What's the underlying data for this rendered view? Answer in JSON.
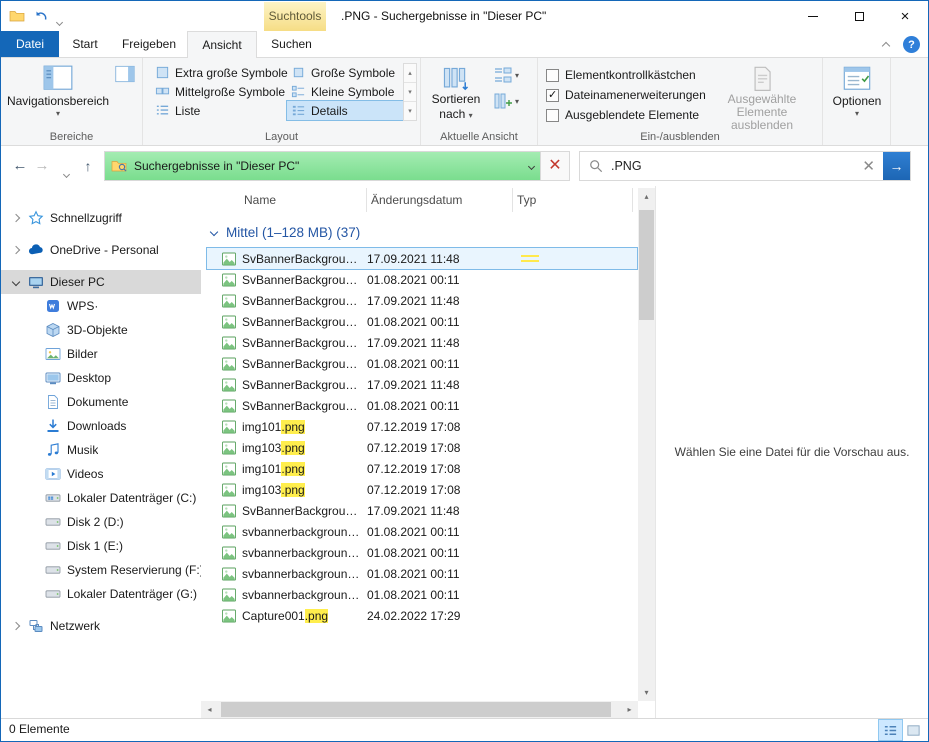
{
  "colors": {
    "accent": "#1467b8",
    "green": "#7add8e",
    "green-light": "#a4ecb2",
    "highlight": "#ffee4d",
    "selbg": "#e9f5fe",
    "selborder": "#7fbbe8",
    "contextual": "#f6dd85"
  },
  "titlebar": {
    "title": ".PNG - Suchergebnisse in \"Dieser PC\"",
    "contextual_tab": "Suchtools"
  },
  "tabs": {
    "file": "Datei",
    "start": "Start",
    "share": "Freigeben",
    "view": "Ansicht",
    "search": "Suchen"
  },
  "ribbon": {
    "panes_group": {
      "label": "Bereiche",
      "nav_pane": "Navigationsbereich"
    },
    "layout_group": {
      "label": "Layout",
      "options": [
        {
          "label": "Extra große Symbole",
          "icon": "xl-icons",
          "selected": false
        },
        {
          "label": "Große Symbole",
          "icon": "l-icons",
          "selected": false
        },
        {
          "label": "Mittelgroße Symbole",
          "icon": "m-icons",
          "selected": false
        },
        {
          "label": "Kleine Symbole",
          "icon": "s-icons",
          "selected": false
        },
        {
          "label": "Liste",
          "icon": "list-view",
          "selected": false
        },
        {
          "label": "Details",
          "icon": "details-view",
          "selected": true
        }
      ]
    },
    "current_view_group": {
      "label": "Aktuelle Ansicht",
      "sort_line1": "Sortieren",
      "sort_line2": "nach"
    },
    "show_hide_group": {
      "label": "Ein-/ausblenden",
      "checkboxes": [
        {
          "label": "Elementkontrollkästchen",
          "checked": false
        },
        {
          "label": "Dateinamenerweiterungen",
          "checked": true
        },
        {
          "label": "Ausgeblendete Elemente",
          "checked": false
        }
      ],
      "hide_selected": "Ausgewählte Elemente ausblenden"
    },
    "options_group": {
      "label": "Optionen"
    }
  },
  "addressbar": {
    "location": "Suchergebnisse in \"Dieser PC\""
  },
  "searchbox": {
    "value": ".PNG"
  },
  "sidebar": {
    "items": [
      {
        "label": "Schnellzugriff",
        "icon": "star",
        "level": 0,
        "chev": "right",
        "gap_after": true
      },
      {
        "label": "OneDrive - Personal",
        "icon": "cloud",
        "level": 0,
        "chev": "right",
        "gap_after": true
      },
      {
        "label": "Dieser PC",
        "icon": "computer",
        "level": 0,
        "chev": "down",
        "selected": true
      },
      {
        "label": "WPS·",
        "icon": "wps",
        "level": 1
      },
      {
        "label": "3D-Objekte",
        "icon": "cube",
        "level": 1
      },
      {
        "label": "Bilder",
        "icon": "picture",
        "level": 1
      },
      {
        "label": "Desktop",
        "icon": "desktop",
        "level": 1
      },
      {
        "label": "Dokumente",
        "icon": "document",
        "level": 1
      },
      {
        "label": "Downloads",
        "icon": "download",
        "level": 1
      },
      {
        "label": "Musik",
        "icon": "music",
        "level": 1
      },
      {
        "label": "Videos",
        "icon": "video",
        "level": 1
      },
      {
        "label": "Lokaler Datenträger (C:)",
        "icon": "drive-win",
        "level": 1
      },
      {
        "label": "Disk 2 (D:)",
        "icon": "drive",
        "level": 1
      },
      {
        "label": "Disk 1 (E:)",
        "icon": "drive",
        "level": 1
      },
      {
        "label": "System Reservierung (F:)",
        "icon": "drive",
        "level": 1
      },
      {
        "label": "Lokaler Datenträger (G:)",
        "icon": "drive",
        "level": 1
      },
      {
        "label": "Netzwerk",
        "icon": "network",
        "level": 0,
        "chev": "right",
        "gap_before": true
      }
    ]
  },
  "filelist": {
    "columns": [
      {
        "label": "Name"
      },
      {
        "label": "Änderungsdatum"
      },
      {
        "label": "Typ"
      }
    ],
    "group": {
      "label": "Mittel (1–128 MB) (37)"
    },
    "rows": [
      {
        "name": "SvBannerBackgrou…",
        "date": "17.09.2021 11:48",
        "selected": true,
        "typ_mark": true
      },
      {
        "name": "SvBannerBackgrou…",
        "date": "01.08.2021 00:11"
      },
      {
        "name": "SvBannerBackgrou…",
        "date": "17.09.2021 11:48"
      },
      {
        "name": "SvBannerBackgrou…",
        "date": "01.08.2021 00:11"
      },
      {
        "name": "SvBannerBackgrou…",
        "date": "17.09.2021 11:48"
      },
      {
        "name": "SvBannerBackgrou…",
        "date": "01.08.2021 00:11"
      },
      {
        "name": "SvBannerBackgrou…",
        "date": "17.09.2021 11:48"
      },
      {
        "name": "SvBannerBackgrou…",
        "date": "01.08.2021 00:11"
      },
      {
        "name": "img101",
        "ext": ".png",
        "date": "07.12.2019 17:08"
      },
      {
        "name": "img103",
        "ext": ".png",
        "date": "07.12.2019 17:08"
      },
      {
        "name": "img101",
        "ext": ".png",
        "date": "07.12.2019 17:08"
      },
      {
        "name": "img103",
        "ext": ".png",
        "date": "07.12.2019 17:08"
      },
      {
        "name": "SvBannerBackgrou…",
        "date": "17.09.2021 11:48"
      },
      {
        "name": "svbannerbackgroun…",
        "date": "01.08.2021 00:11"
      },
      {
        "name": "svbannerbackgroun…",
        "date": "01.08.2021 00:11"
      },
      {
        "name": "svbannerbackgroun…",
        "date": "01.08.2021 00:11"
      },
      {
        "name": "svbannerbackgroun…",
        "date": "01.08.2021 00:11"
      },
      {
        "name": "Capture001",
        "ext": ".png",
        "date": "24.02.2022 17:29"
      }
    ]
  },
  "preview": {
    "placeholder": "Wählen Sie eine Datei für die Vorschau aus."
  },
  "statusbar": {
    "count": "0 Elemente"
  }
}
